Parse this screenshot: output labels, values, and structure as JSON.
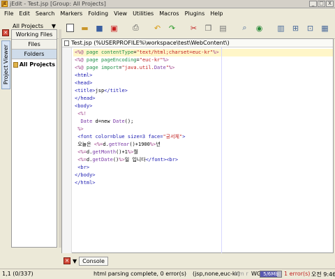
{
  "window": {
    "title": "jEdit - Test.jsp [Group: All Projects]",
    "app_icon_letters": "JE",
    "buttons": [
      "_",
      "□",
      "X"
    ]
  },
  "menubar": [
    "File",
    "Edit",
    "Search",
    "Markers",
    "Folding",
    "View",
    "Utilities",
    "Macros",
    "Plugins",
    "Help"
  ],
  "project": {
    "selector": "All Projects",
    "tabs": [
      "Working Files",
      "Files",
      "Folders"
    ],
    "active_tab": "Folders",
    "tree_root": "All Projects",
    "side_tab": "Project Viewer"
  },
  "buffer": {
    "title": "Test.jsp (%USERPROFILE%\\workspace\\test\\WebContent\\)"
  },
  "code": [
    "<%@ page contentType=\"text/html;charset=euc-kr\"%>",
    "<%@ page pageEncoding=\"euc-kr\"%>",
    "<%@ page import=\"java.util.Date\"%>",
    "<html>",
    "<head>",
    "<title>jsp</title>",
    "</head>",
    "<body>",
    " <%!",
    "  Date d=new Date();",
    " %>",
    " <font color=blue size=3 face=\"궁서체\">",
    " 오늘은 <%=d.getYear()+1900%>년",
    " <%=d.getMonth()+1%>월",
    " <%=d.getDate()%>일 입니다</font><br>",
    " <br>",
    "</body>",
    "</html>"
  ],
  "bottom": {
    "console_label": "Console"
  },
  "status": {
    "caret": "1,1 (0/337)",
    "message": "html parsing complete, 0 error(s)",
    "mode": "(jsp,none,euc-kr)",
    "flags": "Nm r",
    "memory_label": "WG",
    "memory_value": "5/6Mb",
    "memory_fraction": 0.8,
    "errors": "1 error(s)",
    "clock": "오전 9:46"
  }
}
